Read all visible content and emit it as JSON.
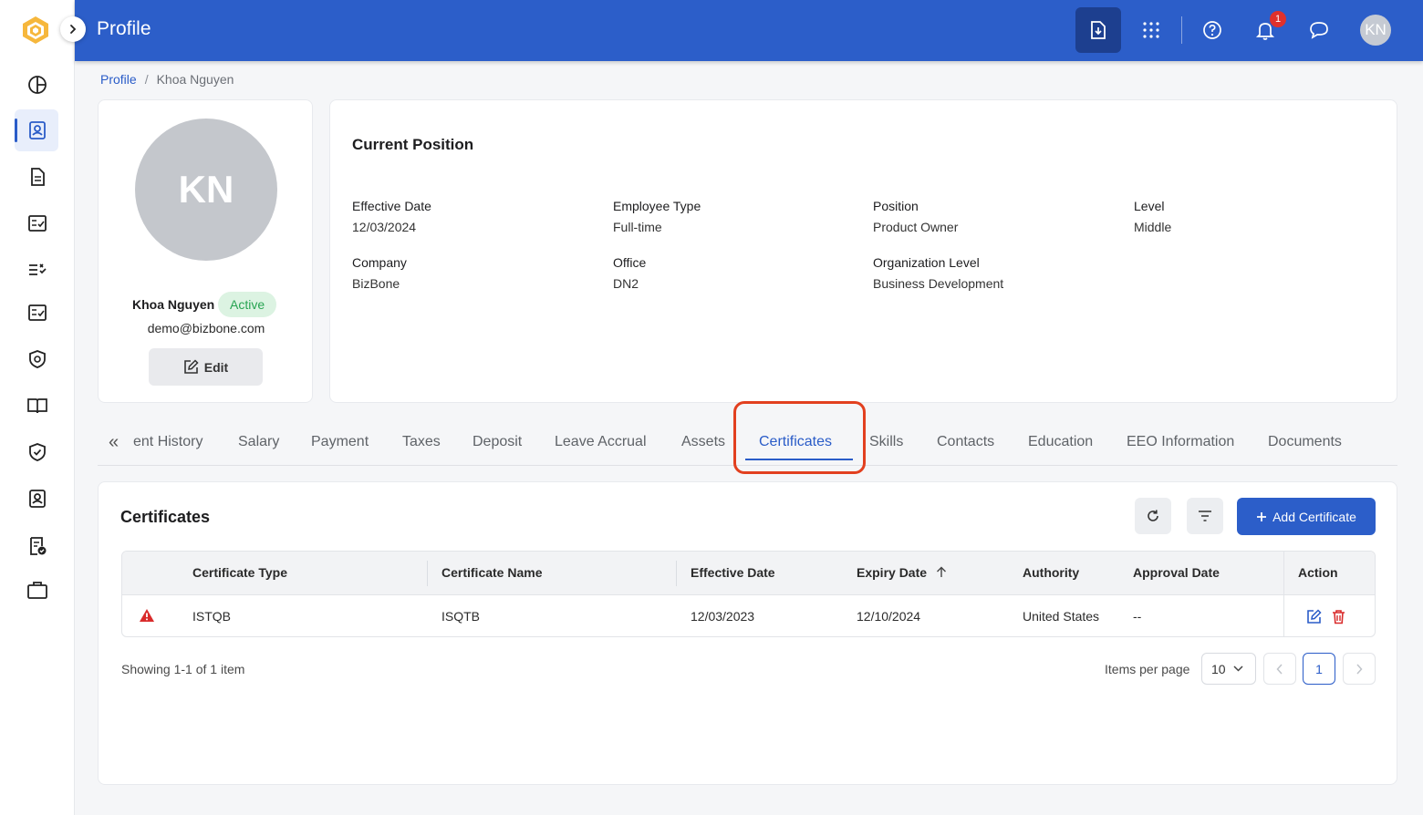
{
  "topbar": {
    "title": "Profile",
    "notification_count": "1",
    "avatar_initials": "KN"
  },
  "breadcrumb": {
    "root": "Profile",
    "current": "Khoa Nguyen"
  },
  "profile": {
    "initials": "KN",
    "name": "Khoa Nguyen",
    "status": "Active",
    "email": "demo@bizbone.com",
    "edit_label": "Edit"
  },
  "position": {
    "title": "Current Position",
    "fields": [
      {
        "label": "Effective Date",
        "value": "12/03/2024"
      },
      {
        "label": "Employee Type",
        "value": "Full-time"
      },
      {
        "label": "Position",
        "value": "Product Owner"
      },
      {
        "label": "Level",
        "value": "Middle"
      },
      {
        "label": "Company",
        "value": "BizBone"
      },
      {
        "label": "Office",
        "value": "DN2"
      },
      {
        "label": "Organization Level",
        "value": "Business Development"
      }
    ]
  },
  "tabs": {
    "prev_icon": "«",
    "items": [
      {
        "label": "ent History"
      },
      {
        "label": "Salary"
      },
      {
        "label": "Payment"
      },
      {
        "label": "Taxes"
      },
      {
        "label": "Deposit"
      },
      {
        "label": "Leave Accrual"
      },
      {
        "label": "Assets"
      },
      {
        "label": "Certificates",
        "active": true
      },
      {
        "label": "Skills"
      },
      {
        "label": "Contacts"
      },
      {
        "label": "Education"
      },
      {
        "label": "EEO Information"
      },
      {
        "label": "Documents"
      }
    ]
  },
  "certificates": {
    "title": "Certificates",
    "add_label": "Add Certificate",
    "columns": [
      "Certificate Type",
      "Certificate Name",
      "Effective Date",
      "Expiry Date",
      "Authority",
      "Approval Date",
      "Action"
    ],
    "rows": [
      {
        "type": "ISTQB",
        "name": "ISQTB",
        "effective_date": "12/03/2023",
        "expiry_date": "12/10/2024",
        "authority": "United States",
        "approval_date": "--"
      }
    ],
    "showing": "Showing 1-1 of 1 item",
    "items_per_page_label": "Items per page",
    "items_per_page": "10",
    "current_page": "1"
  },
  "colors": {
    "primary": "#2c5ec9",
    "active_status_bg": "#dcf3e2",
    "active_status_text": "#28a452",
    "warning": "#d92b2b",
    "delete": "#d92b2b",
    "highlight": "#e2401f"
  },
  "icons": {
    "sidebar": [
      "dashboard-icon",
      "profile-icon",
      "document-icon",
      "checklist-icon",
      "task-list-icon",
      "review-icon",
      "security-icon",
      "book-icon",
      "shield-icon",
      "user-card-icon",
      "approval-icon",
      "briefcase-icon"
    ],
    "topbar": [
      "download-icon",
      "apps-grid-icon",
      "help-icon",
      "bell-icon",
      "chat-icon"
    ]
  }
}
